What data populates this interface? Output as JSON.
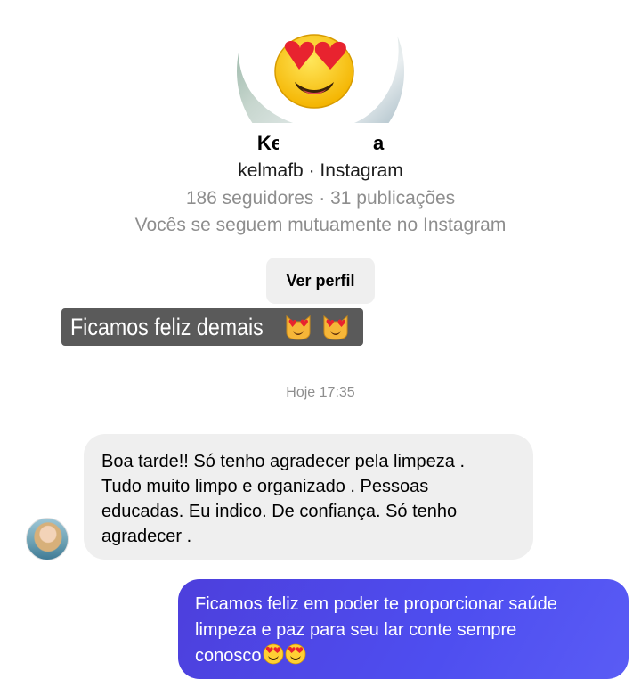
{
  "profile": {
    "name_visible": "Ke",
    "name_tail": "a",
    "handle_line": "kelmafb · Instagram",
    "stats": "186 seguidores · 31 publicações",
    "mutual": "Vocês se seguem mutuamente no Instagram",
    "view_profile_label": "Ver perfil"
  },
  "story_caption": {
    "text": "Ficamos feliz demais"
  },
  "thread": {
    "timestamp": "Hoje 17:35",
    "incoming_message": "Boa tarde!!  Só tenho agradecer pela limpeza .\nTudo muito  limpo e organizado . Pessoas\neducadas. Eu indico.  De confiança.  Só tenho\nagradecer .",
    "outgoing_message": "Ficamos feliz em poder te proporcionar saúde\nlimpeza e paz para seu lar conte sempre\nconosco"
  },
  "icons": {
    "profile_sticker": "heart-eyes-emoji",
    "caption_emojis": [
      "heart-eyes-cat-emoji",
      "heart-eyes-cat-emoji"
    ],
    "outgoing_emojis": [
      "heart-eyes-emoji",
      "heart-eyes-emoji"
    ]
  },
  "colors": {
    "outgoing_bubble": "#4e4ef0",
    "incoming_bubble": "#efefef",
    "caption_background": "#5a5a5a",
    "secondary_text": "#8e8e8e"
  }
}
